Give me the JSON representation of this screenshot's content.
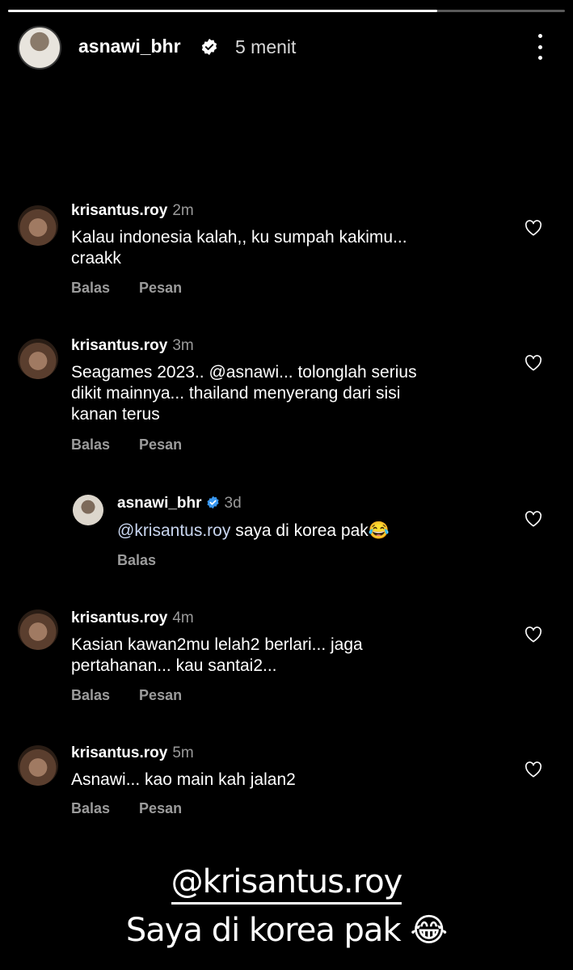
{
  "story": {
    "username": "asnawi_bhr",
    "time": "5 menit",
    "progress": 0.77
  },
  "comments": [
    {
      "username": "krisantus.roy",
      "time": "2m",
      "text": "Kalau indonesia kalah,, ku sumpah kakimu...\ncraakk",
      "reply_label": "Balas",
      "message_label": "Pesan"
    },
    {
      "username": "krisantus.roy",
      "time": "3m",
      "text": "Seagames 2023.. @asnawi... tolonglah serius\ndikit mainnya... thailand menyerang dari sisi\nkanan terus",
      "reply_label": "Balas",
      "message_label": "Pesan"
    },
    {
      "username": "asnawi_bhr",
      "time": "3d",
      "mention": "@krisantus.roy",
      "text": " saya di korea pak😂",
      "reply_label": "Balas"
    },
    {
      "username": "krisantus.roy",
      "time": "4m",
      "text": "Kasian kawan2mu lelah2 berlari... jaga\npertahanan... kau santai2...",
      "reply_label": "Balas",
      "message_label": "Pesan"
    },
    {
      "username": "krisantus.roy",
      "time": "5m",
      "text": "Asnawi... kao main kah jalan2",
      "reply_label": "Balas",
      "message_label": "Pesan"
    }
  ],
  "sticker": {
    "mention": "@krisantus.roy",
    "text": "Saya di korea pak",
    "emoji": "😂"
  },
  "icons": {
    "verified": "verified-badge-icon",
    "heart": "heart-outline-icon",
    "more": "more-vertical-icon"
  },
  "colors": {
    "background": "#000000",
    "verified_blue": "#3897f0",
    "muted": "#9b9b9b"
  }
}
